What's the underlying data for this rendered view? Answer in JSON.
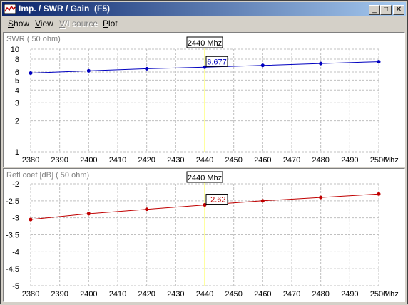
{
  "window": {
    "title": "Imp. / SWR / Gain  (F5)",
    "buttons": {
      "minimize": "_",
      "maximize": "□",
      "close": "✕"
    }
  },
  "menu": {
    "items": [
      {
        "label": "Show",
        "key": "S",
        "rest": "how",
        "enabled": true
      },
      {
        "label": "View",
        "key": "V",
        "rest": "iew",
        "enabled": true
      },
      {
        "label": "V/I source",
        "key": "V",
        "rest": "/I source",
        "enabled": false
      },
      {
        "label": "Plot",
        "key": "P",
        "rest": "lot",
        "enabled": true
      }
    ]
  },
  "colors": {
    "swr_series": "#0000c0",
    "refl_series": "#c00000",
    "cursor_line": "#ffff80",
    "grid": "#c0c0c0"
  },
  "chart_data": [
    {
      "type": "line",
      "title": "SWR ( 50 ohm)",
      "xunit": "Mhz",
      "yscale": "log",
      "xlim": [
        2380,
        2500
      ],
      "ylim": [
        1,
        10
      ],
      "x_ticks": [
        2380,
        2390,
        2400,
        2410,
        2420,
        2430,
        2440,
        2450,
        2460,
        2470,
        2480,
        2490,
        2500
      ],
      "y_ticks": [
        1,
        2,
        3,
        4,
        5,
        6,
        8,
        10
      ],
      "x": [
        2380,
        2400,
        2420,
        2440,
        2460,
        2480,
        2500
      ],
      "y": [
        5.85,
        6.15,
        6.45,
        6.677,
        6.95,
        7.25,
        7.55
      ],
      "cursor": {
        "x": 2440,
        "label": "2440 Mhz",
        "value_label": "6.677"
      }
    },
    {
      "type": "line",
      "title": "Refl coef [dB] ( 50 ohm)",
      "xunit": "Mhz",
      "xlim": [
        2380,
        2500
      ],
      "ylim": [
        -5,
        -2
      ],
      "x_ticks": [
        2380,
        2390,
        2400,
        2410,
        2420,
        2430,
        2440,
        2450,
        2460,
        2470,
        2480,
        2490,
        2500
      ],
      "y_ticks": [
        -2,
        -2.5,
        -3,
        -3.5,
        -4,
        -4.5,
        -5
      ],
      "x": [
        2380,
        2400,
        2420,
        2440,
        2460,
        2480,
        2500
      ],
      "y": [
        -3.05,
        -2.88,
        -2.75,
        -2.62,
        -2.5,
        -2.4,
        -2.3
      ],
      "cursor": {
        "x": 2440,
        "label": "2440 Mhz",
        "value_label": "-2.62"
      }
    }
  ]
}
